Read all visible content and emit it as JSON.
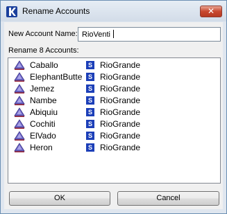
{
  "window": {
    "title": "Rename Accounts"
  },
  "form": {
    "name_label": "New Account Name:",
    "name_value": "RioVenti",
    "rename_label": "Rename 8 Accounts:"
  },
  "accounts": [
    {
      "name": "Caballo",
      "badge": "S",
      "basin": "RioGrande",
      "icon": "reservoir-icon"
    },
    {
      "name": "ElephantButte",
      "badge": "S",
      "basin": "RioGrande",
      "icon": "reservoir-icon"
    },
    {
      "name": "Jemez",
      "badge": "S",
      "basin": "RioGrande",
      "icon": "reservoir-icon"
    },
    {
      "name": "Nambe",
      "badge": "S",
      "basin": "RioGrande",
      "icon": "reservoir-icon"
    },
    {
      "name": "Abiquiu",
      "badge": "S",
      "basin": "RioGrande",
      "icon": "reservoir-icon"
    },
    {
      "name": "Cochiti",
      "badge": "S",
      "basin": "RioGrande",
      "icon": "reservoir-icon"
    },
    {
      "name": "ElVado",
      "badge": "S",
      "basin": "RioGrande",
      "icon": "reservoir-icon"
    },
    {
      "name": "Heron",
      "badge": "S",
      "basin": "RioGrande",
      "icon": "reservoir-icon"
    }
  ],
  "buttons": {
    "ok": "OK",
    "cancel": "Cancel"
  },
  "colors": {
    "badge": "#1c3fb8",
    "icon_triangle": "#6f67c9",
    "icon_base": "#a03040",
    "close_button": "#c8482f"
  }
}
